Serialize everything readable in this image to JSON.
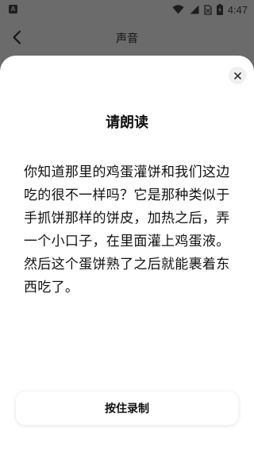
{
  "status_bar": {
    "app_icon_letter": "A",
    "time": "4:47",
    "icons": [
      "wifi-icon",
      "signal-icon",
      "no-sim-icon",
      "battery-charging-icon"
    ]
  },
  "header": {
    "title": "声音",
    "back_icon": "chevron-left-icon"
  },
  "sheet": {
    "close_icon": "close-icon",
    "title": "请朗读",
    "passage": "你知道那里的鸡蛋灌饼和我们这边吃的很不一样吗？它是那种类似于手抓饼那样的饼皮，加热之后，弄一个小口子，在里面灌上鸡蛋液。然后这个蛋饼熟了之后就能裹着东西吃了。",
    "record_button_label": "按住录制"
  },
  "colors": {
    "overlay": "#6b6b6b",
    "sheet": "#ffffff",
    "text": "#111111"
  }
}
